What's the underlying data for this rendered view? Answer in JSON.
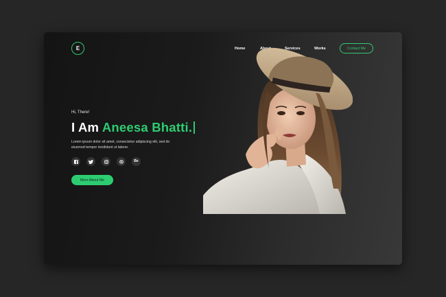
{
  "brand": {
    "logo_letter": "E",
    "accent": "#2ecc71",
    "background": "#262626"
  },
  "nav": {
    "items": [
      "Home",
      "About",
      "Services",
      "Works"
    ],
    "contact_label": "Contact Me"
  },
  "hero": {
    "greeting": "Hi, There!",
    "headline_prefix": "I Am ",
    "headline_name": "Aneesa Bhatti.",
    "description": "Lorem ipsum dolor sit amet, consectetur adipiscing elit, sed do eiusmod tempor incididunt ut labore.",
    "socials": [
      "facebook-icon",
      "twitter-icon",
      "instagram-icon",
      "dribbble-icon",
      "behance-icon"
    ],
    "cta_label": "More About Me"
  }
}
